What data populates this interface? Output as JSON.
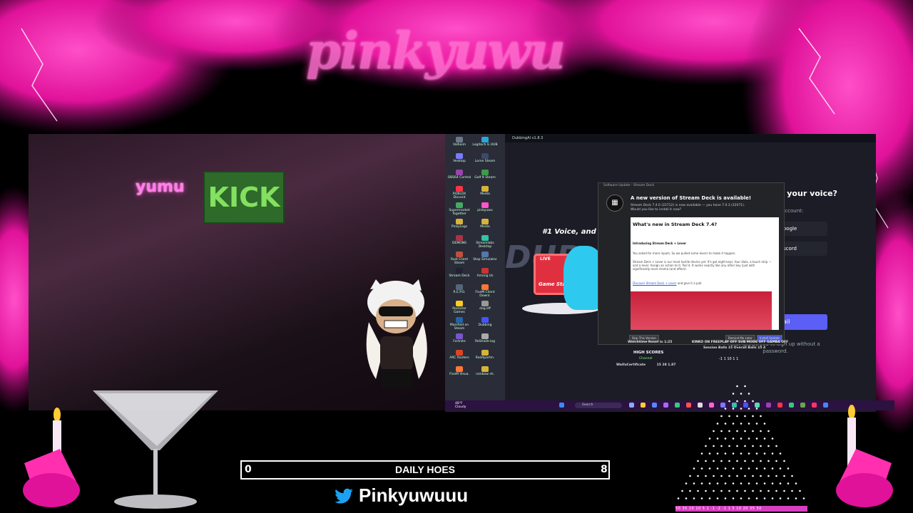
{
  "branding": {
    "logo_text": "pinkyuwu"
  },
  "webcam": {
    "neon_sign_text": "yumu",
    "board_text": "KICK"
  },
  "desktop_icons": [
    {
      "label": "Valheim",
      "color": "#6a7a88"
    },
    {
      "label": "Logitech G HUB",
      "color": "#2aa6d8"
    },
    {
      "label": "Vesktop",
      "color": "#7a7aff"
    },
    {
      "label": "Lorne Steam",
      "color": "#3b4a66"
    },
    {
      "label": "OBS64 Control",
      "color": "#9944aa"
    },
    {
      "label": "Golf It Steam",
      "color": "#3f9a4a"
    },
    {
      "label": "ROBLOX Discord",
      "color": "#ff3344"
    },
    {
      "label": "Media",
      "color": "#d6b43a"
    },
    {
      "label": "Supermarket Together",
      "color": "#44aa66"
    },
    {
      "label": "pinkyuwu",
      "color": "#ff55cc"
    },
    {
      "label": "PinkyLogs",
      "color": "#d6b43a"
    },
    {
      "label": "Media",
      "color": "#d6b43a"
    },
    {
      "label": "DEMONS",
      "color": "#aa3344"
    },
    {
      "label": "Streamlabs Desktop",
      "color": "#31c3a2"
    },
    {
      "label": "Rust Client Steam",
      "color": "#c0503a"
    },
    {
      "label": "Stop Simulator",
      "color": "#5577aa"
    },
    {
      "label": "Stream Deck",
      "color": "#222233"
    },
    {
      "label": "Among Us",
      "color": "#cc3333"
    },
    {
      "label": "R.E.P.O.",
      "color": "#556677"
    },
    {
      "label": "FiveM Client Downl.",
      "color": "#ff7733"
    },
    {
      "label": "Rockstar Games",
      "color": "#ffcc22"
    },
    {
      "label": "dog.eff",
      "color": "#999999"
    },
    {
      "label": "Manifold on Steam",
      "color": "#2266aa"
    },
    {
      "label": "Dubbing",
      "color": "#4455ff"
    },
    {
      "label": "Fortnite",
      "color": "#7755cc"
    },
    {
      "label": "ReShade.log",
      "color": "#aaaaaa"
    },
    {
      "label": "ARC Raiders",
      "color": "#dd4422"
    },
    {
      "label": "RedApartm.",
      "color": "#d6b43a"
    },
    {
      "label": "FiveM Visua.",
      "color": "#ff7733"
    },
    {
      "label": "rainbow sh.",
      "color": "#d6b43a"
    }
  ],
  "app_window": {
    "title": "DubbingAI v1.8.3",
    "tagline": "#1 Voice, and Its F",
    "logo_text": "DUB",
    "live_tag": "LIVE",
    "game_start": "Game Start",
    "login_question": "r your voice?",
    "account_label": "account:",
    "google_label": "oogle",
    "discord_label": "scord",
    "email_label": "ail",
    "signup_text": "that allows you to sign up without a password."
  },
  "stream_deck": {
    "title": "Software Update - Stream Deck",
    "heading": "A new version of Stream Deck is available!",
    "sub_line1": "Stream Deck 7.4.0 (22712) is now available — you have 7.0.3 (22071).",
    "sub_line2": "Would you like to install it now?",
    "notes_heading": "What's new in Stream Deck 7.4?",
    "intro": "Introducing Stream Deck + Lever",
    "para1": "You asked for more inputs. So we pulled some levers to make it happen.",
    "para2": "Stream Deck + Lever is our most tactile device yet. It's got eight keys, four dials, a touch strip — and a lever. Assign an action to it. Pull it. It works exactly like any other key (just with significantly more drama (and effect).",
    "link": "Discover Stream Deck + Lever",
    "link_tail": "and give it a pull.",
    "skip_label": "Skip This Version",
    "remind_label": "Remind Me Later",
    "install_label": "Install Update"
  },
  "stream_overlay": {
    "watchtime": "Watchtime Reset in 1:25",
    "highscores_title": "HIGH SCORES",
    "highscores_channel": "Channel",
    "highscore_name": "WaifuCertificate",
    "highscore_values": "15   28   1.87",
    "modes": "KINKO ON     FREEPLAY OFF     SUB MODE OFF     GAMBA OFF",
    "session": "Session Balls   15    Overall Balls   15    4",
    "dice": "-1  1  10  1  1"
  },
  "taskbar": {
    "weather_temp": "48°F",
    "weather_desc": "Cloudy",
    "search_placeholder": "Search"
  },
  "goal": {
    "min": "0",
    "title": "DAILY HOES",
    "max": "8"
  },
  "social": {
    "twitter_handle": "Pinkyuwuuu"
  },
  "counter_row": "50 35 20 10 5 1 -1 -2 -1 1 5 10 20 35 50",
  "colors": {
    "accent_pink": "#ff2fb0",
    "taskbar": "#2b1240",
    "email_button": "#5b5ff5"
  }
}
